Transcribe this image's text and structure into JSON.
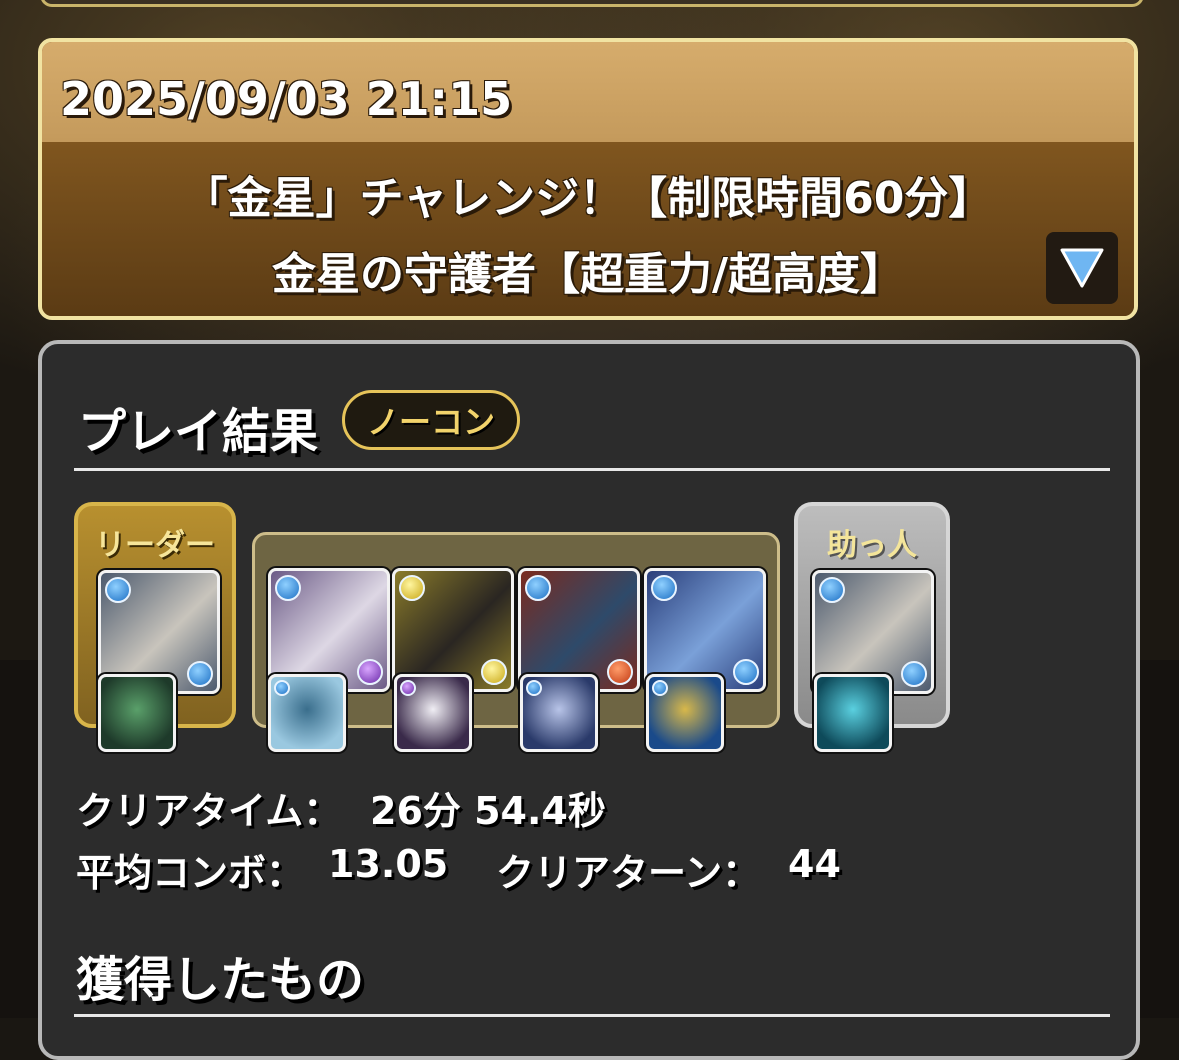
{
  "header": {
    "datetime": "2025/09/03 21:15",
    "title_line1": "「金星」チャレンジ！【制限時間60分】",
    "title_line2": "金星の守護者【超重力/超高度】",
    "expand_icon": "triangle-down-icon"
  },
  "result": {
    "section_title": "プレイ結果",
    "badge": "ノーコン",
    "leader_label": "リーダー",
    "helper_label": "助っ人",
    "team": [
      {
        "slot": "leader",
        "attribute": "water",
        "sub_attribute": "water",
        "colors": [
          "#4c5a6e",
          "#c8c4bc"
        ]
      },
      {
        "slot": "sub1",
        "attribute": "water",
        "sub_attribute": "dark",
        "colors": [
          "#6b5a86",
          "#ddd7e4"
        ]
      },
      {
        "slot": "sub2",
        "attribute": "light",
        "sub_attribute": "light",
        "colors": [
          "#8a7b2a",
          "#2a2622"
        ]
      },
      {
        "slot": "sub3",
        "attribute": "water",
        "sub_attribute": "fire",
        "colors": [
          "#7a2a1e",
          "#2e4a6a"
        ]
      },
      {
        "slot": "sub4",
        "attribute": "water",
        "sub_attribute": "water",
        "colors": [
          "#2a3e7a",
          "#7aa0d8"
        ]
      },
      {
        "slot": "helper",
        "attribute": "water",
        "sub_attribute": "water",
        "colors": [
          "#4c5a6e",
          "#c8c4bc"
        ]
      }
    ],
    "assists": [
      {
        "attribute": "none",
        "colors": [
          "#1e3a2a",
          "#5aa06a"
        ]
      },
      {
        "attribute": "water",
        "colors": [
          "#9ac8e0",
          "#3a6e8c"
        ]
      },
      {
        "attribute": "dark",
        "colors": [
          "#3a2a4a",
          "#f0eef4"
        ]
      },
      {
        "attribute": "water",
        "colors": [
          "#2a3a6a",
          "#b8c4e8"
        ]
      },
      {
        "attribute": "water",
        "colors": [
          "#1a4a8a",
          "#d8b84a"
        ]
      },
      {
        "attribute": "none",
        "colors": [
          "#0e4a5a",
          "#5ad0e0"
        ]
      }
    ],
    "clear_time_label": "クリアタイム：",
    "clear_time_value": "26分 54.4秒",
    "avg_combo_label": "平均コンボ：",
    "avg_combo_value": "13.05",
    "clear_turn_label": "クリアターン：",
    "clear_turn_value": "44",
    "obtained_title": "獲得したもの"
  }
}
